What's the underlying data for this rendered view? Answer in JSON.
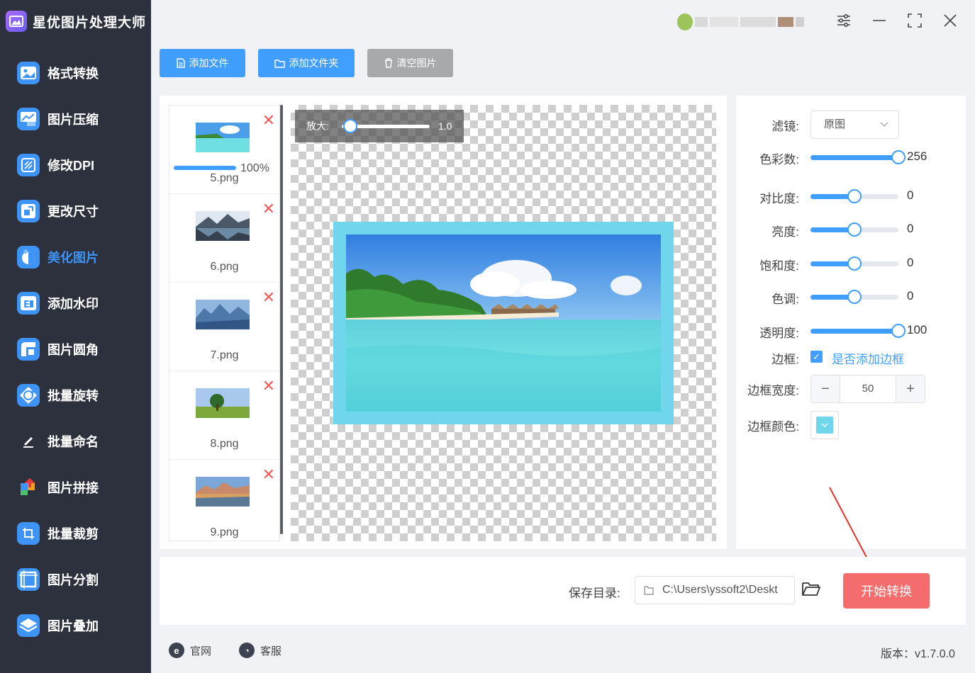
{
  "app": {
    "title": "星优图片处理大师",
    "version": "版本：v1.7.0.0"
  },
  "sidebar": {
    "items": [
      {
        "label": "格式转换",
        "icon": "image-convert-icon",
        "color": "#3e94f5"
      },
      {
        "label": "图片压缩",
        "icon": "image-compress-icon",
        "color": "#3e94f5"
      },
      {
        "label": "修改DPI",
        "icon": "dpi-icon",
        "color": "#3e94f5"
      },
      {
        "label": "更改尺寸",
        "icon": "resize-icon",
        "color": "#3e94f5"
      },
      {
        "label": "美化图片",
        "icon": "beautify-icon",
        "color": "#3e94f5",
        "active": true
      },
      {
        "label": "添加水印",
        "icon": "watermark-icon",
        "color": "#3e94f5"
      },
      {
        "label": "图片圆角",
        "icon": "round-corner-icon",
        "color": "#3e94f5"
      },
      {
        "label": "批量旋转",
        "icon": "rotate-icon",
        "color": "#3e94f5"
      },
      {
        "label": "批量命名",
        "icon": "rename-icon",
        "color": "#3e94f5"
      },
      {
        "label": "图片拼接",
        "icon": "puzzle-icon",
        "color": "#f0a020"
      },
      {
        "label": "批量裁剪",
        "icon": "crop-icon",
        "color": "#3e94f5"
      },
      {
        "label": "图片分割",
        "icon": "split-icon",
        "color": "#3e94f5"
      },
      {
        "label": "图片叠加",
        "icon": "layers-icon",
        "color": "#3e94f5"
      }
    ]
  },
  "toolbar": {
    "add_file": "添加文件",
    "add_folder": "添加文件夹",
    "clear": "清空图片"
  },
  "files": [
    {
      "name": "5.png",
      "progress": "100%",
      "progress_value": 1.0,
      "theme": "beach"
    },
    {
      "name": "6.png",
      "theme": "lake"
    },
    {
      "name": "7.png",
      "theme": "mountains"
    },
    {
      "name": "8.png",
      "theme": "tree"
    },
    {
      "name": "9.png",
      "theme": "sunset"
    }
  ],
  "zoom": {
    "label": "放大:",
    "value": "1.0"
  },
  "settings": {
    "filter": {
      "label": "滤镜:",
      "value": "原图"
    },
    "colors": {
      "label": "色彩数:",
      "value": "256",
      "fraction": 1.0
    },
    "contrast": {
      "label": "对比度:",
      "value": "0",
      "fraction": 0.5
    },
    "brightness": {
      "label": "亮度:",
      "value": "0",
      "fraction": 0.5
    },
    "saturation": {
      "label": "饱和度:",
      "value": "0",
      "fraction": 0.5
    },
    "hue": {
      "label": "色调:",
      "value": "0",
      "fraction": 0.5
    },
    "opacity": {
      "label": "透明度:",
      "value": "100",
      "fraction": 1.0
    },
    "border": {
      "label": "边框:",
      "checkbox_label": "是否添加边框",
      "checked": true
    },
    "border_width": {
      "label": "边框宽度:",
      "value": "50"
    },
    "border_color": {
      "label": "边框颜色:",
      "color": "#6fd6ec"
    }
  },
  "save": {
    "label": "保存目录:",
    "path": "C:\\Users\\yssoft2\\Deskt",
    "start": "开始转换"
  },
  "footer": {
    "website": "官网",
    "support": "客服"
  }
}
